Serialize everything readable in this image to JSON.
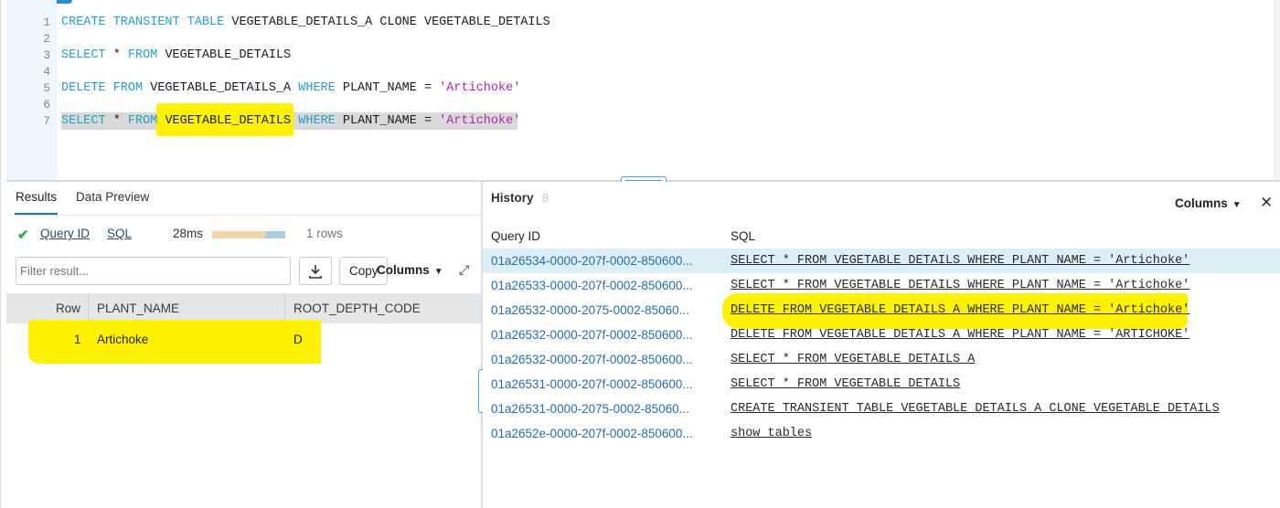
{
  "editor": {
    "lines": [
      {
        "num": "1",
        "parts": [
          {
            "t": "CREATE TRANSIENT TABLE ",
            "c": "kw"
          },
          {
            "t": "VEGETABLE_DETAILS_A CLONE VEGETABLE_DETAILS",
            "c": "plain"
          }
        ]
      },
      {
        "num": "2",
        "parts": []
      },
      {
        "num": "3",
        "parts": [
          {
            "t": "SELECT ",
            "c": "kw"
          },
          {
            "t": "* ",
            "c": "plain"
          },
          {
            "t": "FROM ",
            "c": "kw"
          },
          {
            "t": "VEGETABLE_DETAILS",
            "c": "plain"
          }
        ]
      },
      {
        "num": "4",
        "parts": []
      },
      {
        "num": "5",
        "parts": [
          {
            "t": "DELETE FROM ",
            "c": "kw"
          },
          {
            "t": "VEGETABLE_DETAILS_A ",
            "c": "plain"
          },
          {
            "t": "WHERE ",
            "c": "kw"
          },
          {
            "t": "PLANT_NAME = ",
            "c": "plain"
          },
          {
            "t": "'Artichoke'",
            "c": "str"
          }
        ]
      },
      {
        "num": "6",
        "parts": []
      },
      {
        "num": "7",
        "parts": [
          {
            "t": "SELECT ",
            "c": "kw"
          },
          {
            "t": "* ",
            "c": "plain"
          },
          {
            "t": "FROM ",
            "c": "kw"
          },
          {
            "t": "VEGETABLE_DETAILS ",
            "c": "plain"
          },
          {
            "t": "WHERE ",
            "c": "kw"
          },
          {
            "t": "PLANT_NAME = ",
            "c": "plain"
          },
          {
            "t": "'Artichoke'",
            "c": "str"
          }
        ]
      }
    ]
  },
  "results": {
    "tab_results": "Results",
    "tab_preview": "Data Preview",
    "query_id_link": "Query ID",
    "sql_link": "SQL",
    "duration": "28ms",
    "row_count": "1 rows",
    "filter_placeholder": "Filter result...",
    "copy_label": "Copy",
    "columns_label": "Columns",
    "columns": [
      "Row",
      "PLANT_NAME",
      "ROOT_DEPTH_CODE"
    ],
    "rows": [
      [
        "1",
        "Artichoke",
        "D"
      ]
    ]
  },
  "history": {
    "title": "History",
    "count": "8",
    "columns_label": "Columns",
    "col_query_id": "Query ID",
    "col_sql": "SQL",
    "items": [
      {
        "qid": "01a26534-0000-207f-0002-850600...",
        "sql": "SELECT * FROM VEGETABLE_DETAILS WHERE PLANT_NAME = 'Artichoke'"
      },
      {
        "qid": "01a26533-0000-207f-0002-850600...",
        "sql": "SELECT * FROM VEGETABLE_DETAILS WHERE PLANT_NAME = 'Artichoke'"
      },
      {
        "qid": "01a26532-0000-2075-0002-85060...",
        "sql": "DELETE FROM VEGETABLE_DETAILS_A WHERE PLANT_NAME = 'Artichoke'"
      },
      {
        "qid": "01a26532-0000-207f-0002-850600...",
        "sql": "DELETE FROM VEGETABLE_DETAILS_A WHERE PLANT_NAME = 'ARTICHOKE'"
      },
      {
        "qid": "01a26532-0000-207f-0002-850600...",
        "sql": "SELECT * FROM VEGETABLE_DETAILS_A"
      },
      {
        "qid": "01a26531-0000-207f-0002-850600...",
        "sql": "SELECT * FROM VEGETABLE_DETAILS"
      },
      {
        "qid": "01a26531-0000-2075-0002-85060...",
        "sql": "CREATE TRANSIENT TABLE VEGETABLE_DETAILS_A CLONE VEGETABLE_DETAILS"
      },
      {
        "qid": "01a2652e-0000-207f-0002-850600...",
        "sql": "show tables"
      }
    ]
  }
}
